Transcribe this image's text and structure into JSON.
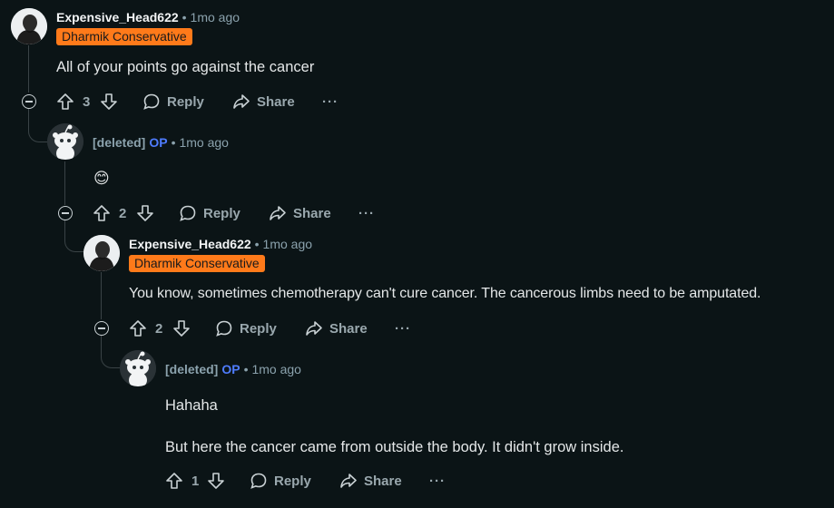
{
  "comments": [
    {
      "username": "Expensive_Head622",
      "op": "",
      "time": "1mo ago",
      "flair": "Dharmik Conservative",
      "body": [
        "All of your points go against the cancer"
      ],
      "votes": "3"
    },
    {
      "username": "[deleted]",
      "op": "OP",
      "time": "1mo ago",
      "flair": "",
      "body": [
        "😊"
      ],
      "votes": "2"
    },
    {
      "username": "Expensive_Head622",
      "op": "",
      "time": "1mo ago",
      "flair": "Dharmik Conservative",
      "body": [
        "You know, sometimes chemotherapy can't cure cancer. The cancerous limbs need to be amputated."
      ],
      "votes": "2"
    },
    {
      "username": "[deleted]",
      "op": "OP",
      "time": "1mo ago",
      "flair": "",
      "body": [
        "Hahaha",
        "But here the cancer came from outside the body. It didn't grow inside."
      ],
      "votes": "1"
    }
  ],
  "actions": {
    "reply": "Reply",
    "share": "Share",
    "more": "···",
    "separator": "•"
  },
  "icons": {
    "upvote": "arrow-up-icon",
    "downvote": "arrow-down-icon",
    "reply": "speech-bubble-icon",
    "share": "share-arrow-icon",
    "collapse": "collapse-minus-icon",
    "avatar_user": "user-avatar-icon",
    "avatar_deleted": "snoo-avatar-icon"
  },
  "colors": {
    "background": "#0b1416",
    "flair": "#ff7a1a",
    "op": "#4f7cff"
  }
}
